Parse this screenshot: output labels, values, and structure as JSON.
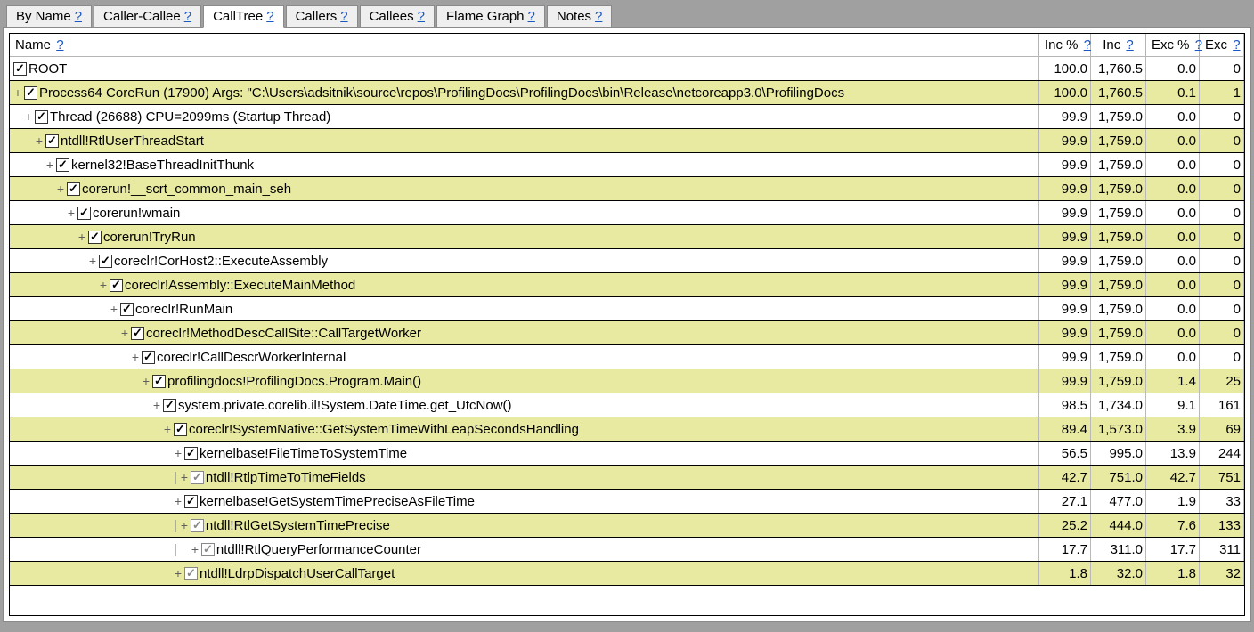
{
  "tabs": [
    {
      "label": "By Name",
      "active": false
    },
    {
      "label": "Caller-Callee",
      "active": false
    },
    {
      "label": "CallTree",
      "active": true
    },
    {
      "label": "Callers",
      "active": false
    },
    {
      "label": "Callees",
      "active": false
    },
    {
      "label": "Flame Graph",
      "active": false
    },
    {
      "label": "Notes",
      "active": false
    }
  ],
  "help_glyph": "?",
  "columns": {
    "name": "Name",
    "incpct": "Inc %",
    "inc": "Inc",
    "excpct": "Exc %",
    "exc": "Exc"
  },
  "rows": [
    {
      "indent": 0,
      "exp": "",
      "pipe": false,
      "chk": "black",
      "hl": false,
      "name": "ROOT",
      "incpct": "100.0",
      "inc": "1,760.5",
      "excpct": "0.0",
      "exc": "0"
    },
    {
      "indent": 0,
      "exp": "+",
      "pipe": false,
      "chk": "black",
      "hl": true,
      "name": "Process64 CoreRun (17900) Args:  \"C:\\Users\\adsitnik\\source\\repos\\ProfilingDocs\\ProfilingDocs\\bin\\Release\\netcoreapp3.0\\ProfilingDocs",
      "incpct": "100.0",
      "inc": "1,760.5",
      "excpct": "0.1",
      "exc": "1"
    },
    {
      "indent": 1,
      "exp": "+",
      "pipe": false,
      "chk": "black",
      "hl": false,
      "name": "Thread (26688) CPU=2099ms (Startup Thread)",
      "incpct": "99.9",
      "inc": "1,759.0",
      "excpct": "0.0",
      "exc": "0"
    },
    {
      "indent": 2,
      "exp": "+",
      "pipe": false,
      "chk": "black",
      "hl": true,
      "name": "ntdll!RtlUserThreadStart",
      "incpct": "99.9",
      "inc": "1,759.0",
      "excpct": "0.0",
      "exc": "0"
    },
    {
      "indent": 3,
      "exp": "+",
      "pipe": false,
      "chk": "black",
      "hl": false,
      "name": "kernel32!BaseThreadInitThunk",
      "incpct": "99.9",
      "inc": "1,759.0",
      "excpct": "0.0",
      "exc": "0"
    },
    {
      "indent": 4,
      "exp": "+",
      "pipe": false,
      "chk": "black",
      "hl": true,
      "name": "corerun!__scrt_common_main_seh",
      "incpct": "99.9",
      "inc": "1,759.0",
      "excpct": "0.0",
      "exc": "0"
    },
    {
      "indent": 5,
      "exp": "+",
      "pipe": false,
      "chk": "black",
      "hl": false,
      "name": "corerun!wmain",
      "incpct": "99.9",
      "inc": "1,759.0",
      "excpct": "0.0",
      "exc": "0"
    },
    {
      "indent": 6,
      "exp": "+",
      "pipe": false,
      "chk": "black",
      "hl": true,
      "name": "corerun!TryRun",
      "incpct": "99.9",
      "inc": "1,759.0",
      "excpct": "0.0",
      "exc": "0"
    },
    {
      "indent": 7,
      "exp": "+",
      "pipe": false,
      "chk": "black",
      "hl": false,
      "name": "coreclr!CorHost2::ExecuteAssembly",
      "incpct": "99.9",
      "inc": "1,759.0",
      "excpct": "0.0",
      "exc": "0"
    },
    {
      "indent": 8,
      "exp": "+",
      "pipe": false,
      "chk": "black",
      "hl": true,
      "name": "coreclr!Assembly::ExecuteMainMethod",
      "incpct": "99.9",
      "inc": "1,759.0",
      "excpct": "0.0",
      "exc": "0"
    },
    {
      "indent": 9,
      "exp": "+",
      "pipe": false,
      "chk": "black",
      "hl": false,
      "name": "coreclr!RunMain",
      "incpct": "99.9",
      "inc": "1,759.0",
      "excpct": "0.0",
      "exc": "0"
    },
    {
      "indent": 10,
      "exp": "+",
      "pipe": false,
      "chk": "black",
      "hl": true,
      "name": "coreclr!MethodDescCallSite::CallTargetWorker",
      "incpct": "99.9",
      "inc": "1,759.0",
      "excpct": "0.0",
      "exc": "0"
    },
    {
      "indent": 11,
      "exp": "+",
      "pipe": false,
      "chk": "black",
      "hl": false,
      "name": "coreclr!CallDescrWorkerInternal",
      "incpct": "99.9",
      "inc": "1,759.0",
      "excpct": "0.0",
      "exc": "0"
    },
    {
      "indent": 12,
      "exp": "+",
      "pipe": false,
      "chk": "black",
      "hl": true,
      "name": "profilingdocs!ProfilingDocs.Program.Main()",
      "incpct": "99.9",
      "inc": "1,759.0",
      "excpct": "1.4",
      "exc": "25"
    },
    {
      "indent": 13,
      "exp": "+",
      "pipe": false,
      "chk": "black",
      "hl": false,
      "name": "system.private.corelib.il!System.DateTime.get_UtcNow()",
      "incpct": "98.5",
      "inc": "1,734.0",
      "excpct": "9.1",
      "exc": "161"
    },
    {
      "indent": 14,
      "exp": "+",
      "pipe": false,
      "chk": "black",
      "hl": true,
      "name": "coreclr!SystemNative::GetSystemTimeWithLeapSecondsHandling",
      "incpct": "89.4",
      "inc": "1,573.0",
      "excpct": "3.9",
      "exc": "69"
    },
    {
      "indent": 15,
      "exp": "+",
      "pipe": false,
      "chk": "black",
      "hl": false,
      "name": "kernelbase!FileTimeToSystemTime",
      "incpct": "56.5",
      "inc": "995.0",
      "excpct": "13.9",
      "exc": "244"
    },
    {
      "indent": 15,
      "exp": "+",
      "pipe": true,
      "chk": "grey",
      "hl": true,
      "name": "ntdll!RtlpTimeToTimeFields",
      "incpct": "42.7",
      "inc": "751.0",
      "excpct": "42.7",
      "exc": "751"
    },
    {
      "indent": 15,
      "exp": "+",
      "pipe": false,
      "chk": "black",
      "hl": false,
      "name": "kernelbase!GetSystemTimePreciseAsFileTime",
      "incpct": "27.1",
      "inc": "477.0",
      "excpct": "1.9",
      "exc": "33"
    },
    {
      "indent": 15,
      "exp": "+",
      "pipe": true,
      "chk": "grey",
      "hl": true,
      "name": "ntdll!RtlGetSystemTimePrecise",
      "incpct": "25.2",
      "inc": "444.0",
      "excpct": "7.6",
      "exc": "133"
    },
    {
      "indent": 15,
      "exp": "+",
      "pipe": true,
      "extra_indent": true,
      "chk": "grey",
      "hl": false,
      "name": "ntdll!RtlQueryPerformanceCounter",
      "incpct": "17.7",
      "inc": "311.0",
      "excpct": "17.7",
      "exc": "311"
    },
    {
      "indent": 15,
      "exp": "+",
      "pipe": false,
      "chk": "grey",
      "hl": true,
      "name": "ntdll!LdrpDispatchUserCallTarget",
      "incpct": "1.8",
      "inc": "32.0",
      "excpct": "1.8",
      "exc": "32"
    }
  ]
}
